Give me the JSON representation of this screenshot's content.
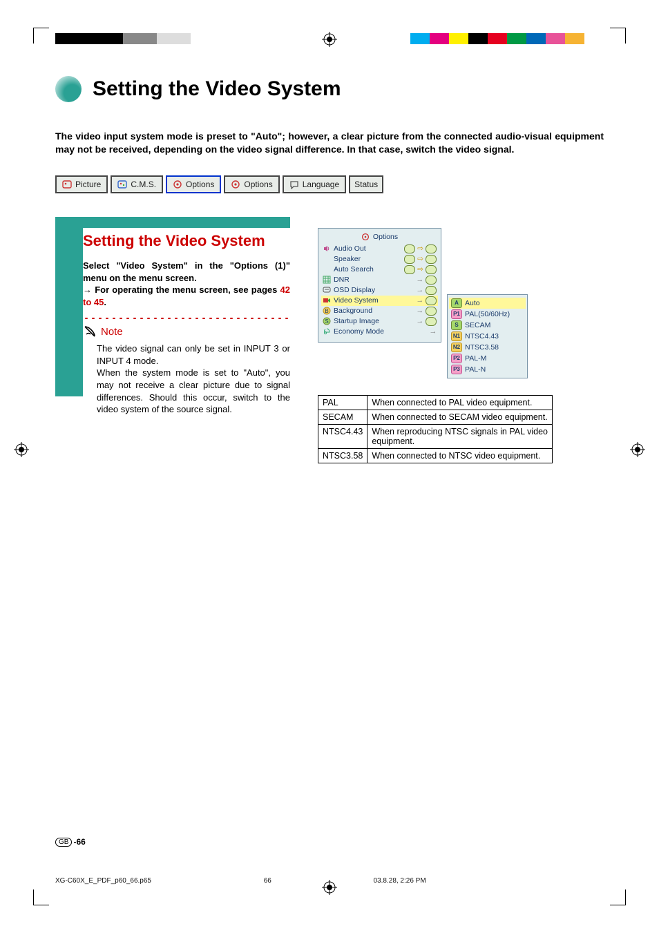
{
  "title": "Setting the Video System",
  "intro": "The video input system mode is preset to \"Auto\"; however, a clear picture from the connected audio-visual equipment may not be received, depending on the video signal difference. In that case, switch the video signal.",
  "tabs": {
    "picture": "Picture",
    "cms": "C.M.S.",
    "options1": "Options",
    "options2": "Options",
    "language": "Language",
    "status": "Status"
  },
  "subhead": "Setting the Video System",
  "instruction_line1": "Select \"Video System\" in the \"Options (1)\" menu on the menu screen.",
  "instruction_line2a": "For operating the menu screen, see pages ",
  "instruction_line2b": "42 to 45",
  "instruction_line2c": ".",
  "note_label": "Note",
  "note_body": "The video signal can only be set in INPUT 3 or INPUT 4 mode.\nWhen the system mode is set to \"Auto\", you may not receive a clear picture due to signal differences. Should this occur, switch to the video system of the source signal.",
  "osd": {
    "header": "Options",
    "rows": [
      {
        "label": "Audio Out",
        "icon": "speaker-out-icon"
      },
      {
        "label": "Speaker",
        "icon": "blank-icon"
      },
      {
        "label": "Auto Search",
        "icon": "blank-icon"
      },
      {
        "label": "DNR",
        "icon": "grid-icon"
      },
      {
        "label": "OSD Display",
        "icon": "screen-icon"
      },
      {
        "label": "Video System",
        "icon": "video-icon",
        "hl": true
      },
      {
        "label": "Background",
        "icon": "b-icon"
      },
      {
        "label": "Startup Image",
        "icon": "s-icon"
      },
      {
        "label": "Economy Mode",
        "icon": "eco-icon"
      }
    ]
  },
  "submenu": [
    {
      "label": "Auto",
      "badge": "A",
      "cls": "b-g",
      "hl": true
    },
    {
      "label": "PAL(50/60Hz)",
      "badge": "P1",
      "cls": "b-m"
    },
    {
      "label": "SECAM",
      "badge": "S",
      "cls": "b-g"
    },
    {
      "label": "NTSC4.43",
      "badge": "N1",
      "cls": "b-y"
    },
    {
      "label": "NTSC3.58",
      "badge": "N2",
      "cls": "b-y"
    },
    {
      "label": "PAL-M",
      "badge": "P2",
      "cls": "b-m"
    },
    {
      "label": "PAL-N",
      "badge": "P3",
      "cls": "b-m"
    }
  ],
  "table": [
    {
      "k": "PAL",
      "v": "When connected to PAL video equipment."
    },
    {
      "k": "SECAM",
      "v": "When connected to SECAM video equipment."
    },
    {
      "k": "NTSC4.43",
      "v": "When reproducing NTSC signals in PAL video equipment."
    },
    {
      "k": "NTSC3.58",
      "v": "When connected to NTSC video equipment."
    }
  ],
  "page_number_prefix": "GB",
  "page_number": "-66",
  "doc_file": "XG-C60X_E_PDF_p60_66.p65",
  "doc_page": "66",
  "doc_date": "03.8.28, 2:26 PM",
  "colors_top_left": [
    "#000",
    "#000",
    "#000",
    "#000",
    "#888",
    "#888",
    "#ddd",
    "#ddd",
    "#fff"
  ],
  "colors_top_right": [
    "#00adef",
    "#e4007f",
    "#fff000",
    "#000",
    "#e5001f",
    "#009944",
    "#0068b7",
    "#e85298",
    "#f6b333",
    "#fff"
  ]
}
